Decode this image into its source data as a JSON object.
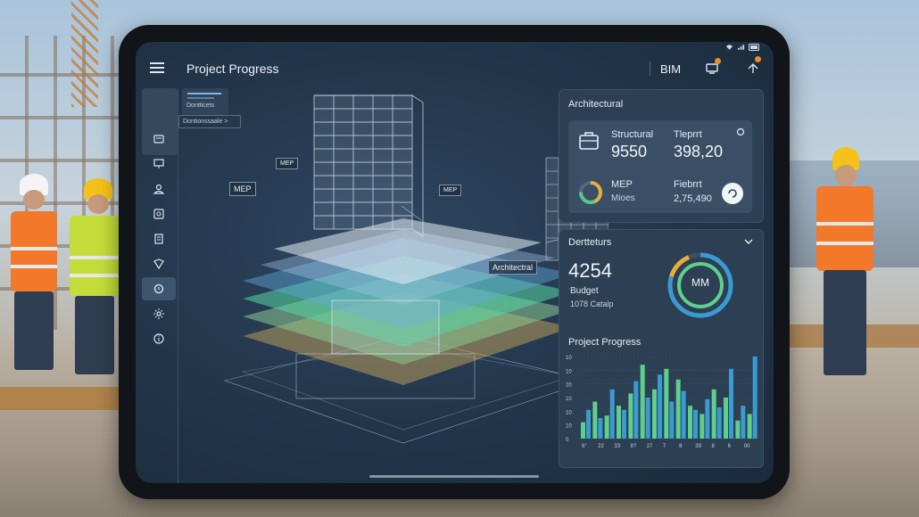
{
  "app": {
    "title": "Project Progress",
    "mode_label": "BIM",
    "accent": "#f08a24"
  },
  "status_bar": {
    "icons": [
      "wifi-icon",
      "signal-icon",
      "battery-icon"
    ]
  },
  "sidebar": {
    "items": [
      {
        "icon": "layers-icon",
        "active": false
      },
      {
        "icon": "monitor-icon",
        "active": false
      },
      {
        "icon": "user-icon",
        "active": false
      },
      {
        "icon": "image-icon",
        "active": false
      },
      {
        "icon": "document-icon",
        "active": false
      },
      {
        "icon": "shield-icon",
        "active": false
      },
      {
        "icon": "layers-active-icon",
        "active": true
      },
      {
        "icon": "settings-icon",
        "active": false
      },
      {
        "icon": "info-icon",
        "active": false
      }
    ]
  },
  "layer_panel": {
    "label": "Dontticets",
    "dropdown": "Dontionssaale >"
  },
  "model_callouts": {
    "mep_1": "MEP",
    "mep_2": "MEP",
    "mep_3": "MEP",
    "architectural": "Architectral"
  },
  "architectural_card": {
    "title": "Architectural",
    "structural_label": "Structural",
    "structural_value": "9550",
    "tleprt_label": "Tleprrt",
    "tleprt_value": "398,20",
    "mep_label": "MEP",
    "mep_sub": "Mioes",
    "fieprt_label": "Fiebrrt",
    "fieprt_value": "2,75,490"
  },
  "details_card": {
    "title": "Dertteturs",
    "value": "4254",
    "budget_label": "Budget",
    "budget_sub": "1078 Catalp",
    "ring_label": "MM"
  },
  "chart_data": {
    "type": "bar",
    "title": "Project Progress",
    "y_ticks": [
      "10",
      "10",
      "20",
      "10",
      "10",
      "10",
      "0"
    ],
    "x_ticks": [
      "6°",
      "22",
      "33",
      "8?",
      "27",
      "7",
      "8",
      "39",
      "8",
      "6",
      "00"
    ],
    "series": [
      {
        "color": "#5fcf8e",
        "values": [
          20,
          45,
          28,
          40,
          55,
          90,
          60,
          85,
          72,
          40,
          30,
          60,
          50,
          22,
          30
        ]
      },
      {
        "color": "#3a9bd1",
        "values": [
          35,
          25,
          60,
          35,
          70,
          50,
          78,
          45,
          58,
          35,
          48,
          38,
          85,
          40,
          100
        ]
      }
    ],
    "ylim": [
      0,
      100
    ],
    "colors": [
      "#5fcf8e",
      "#3a9bd1"
    ]
  }
}
